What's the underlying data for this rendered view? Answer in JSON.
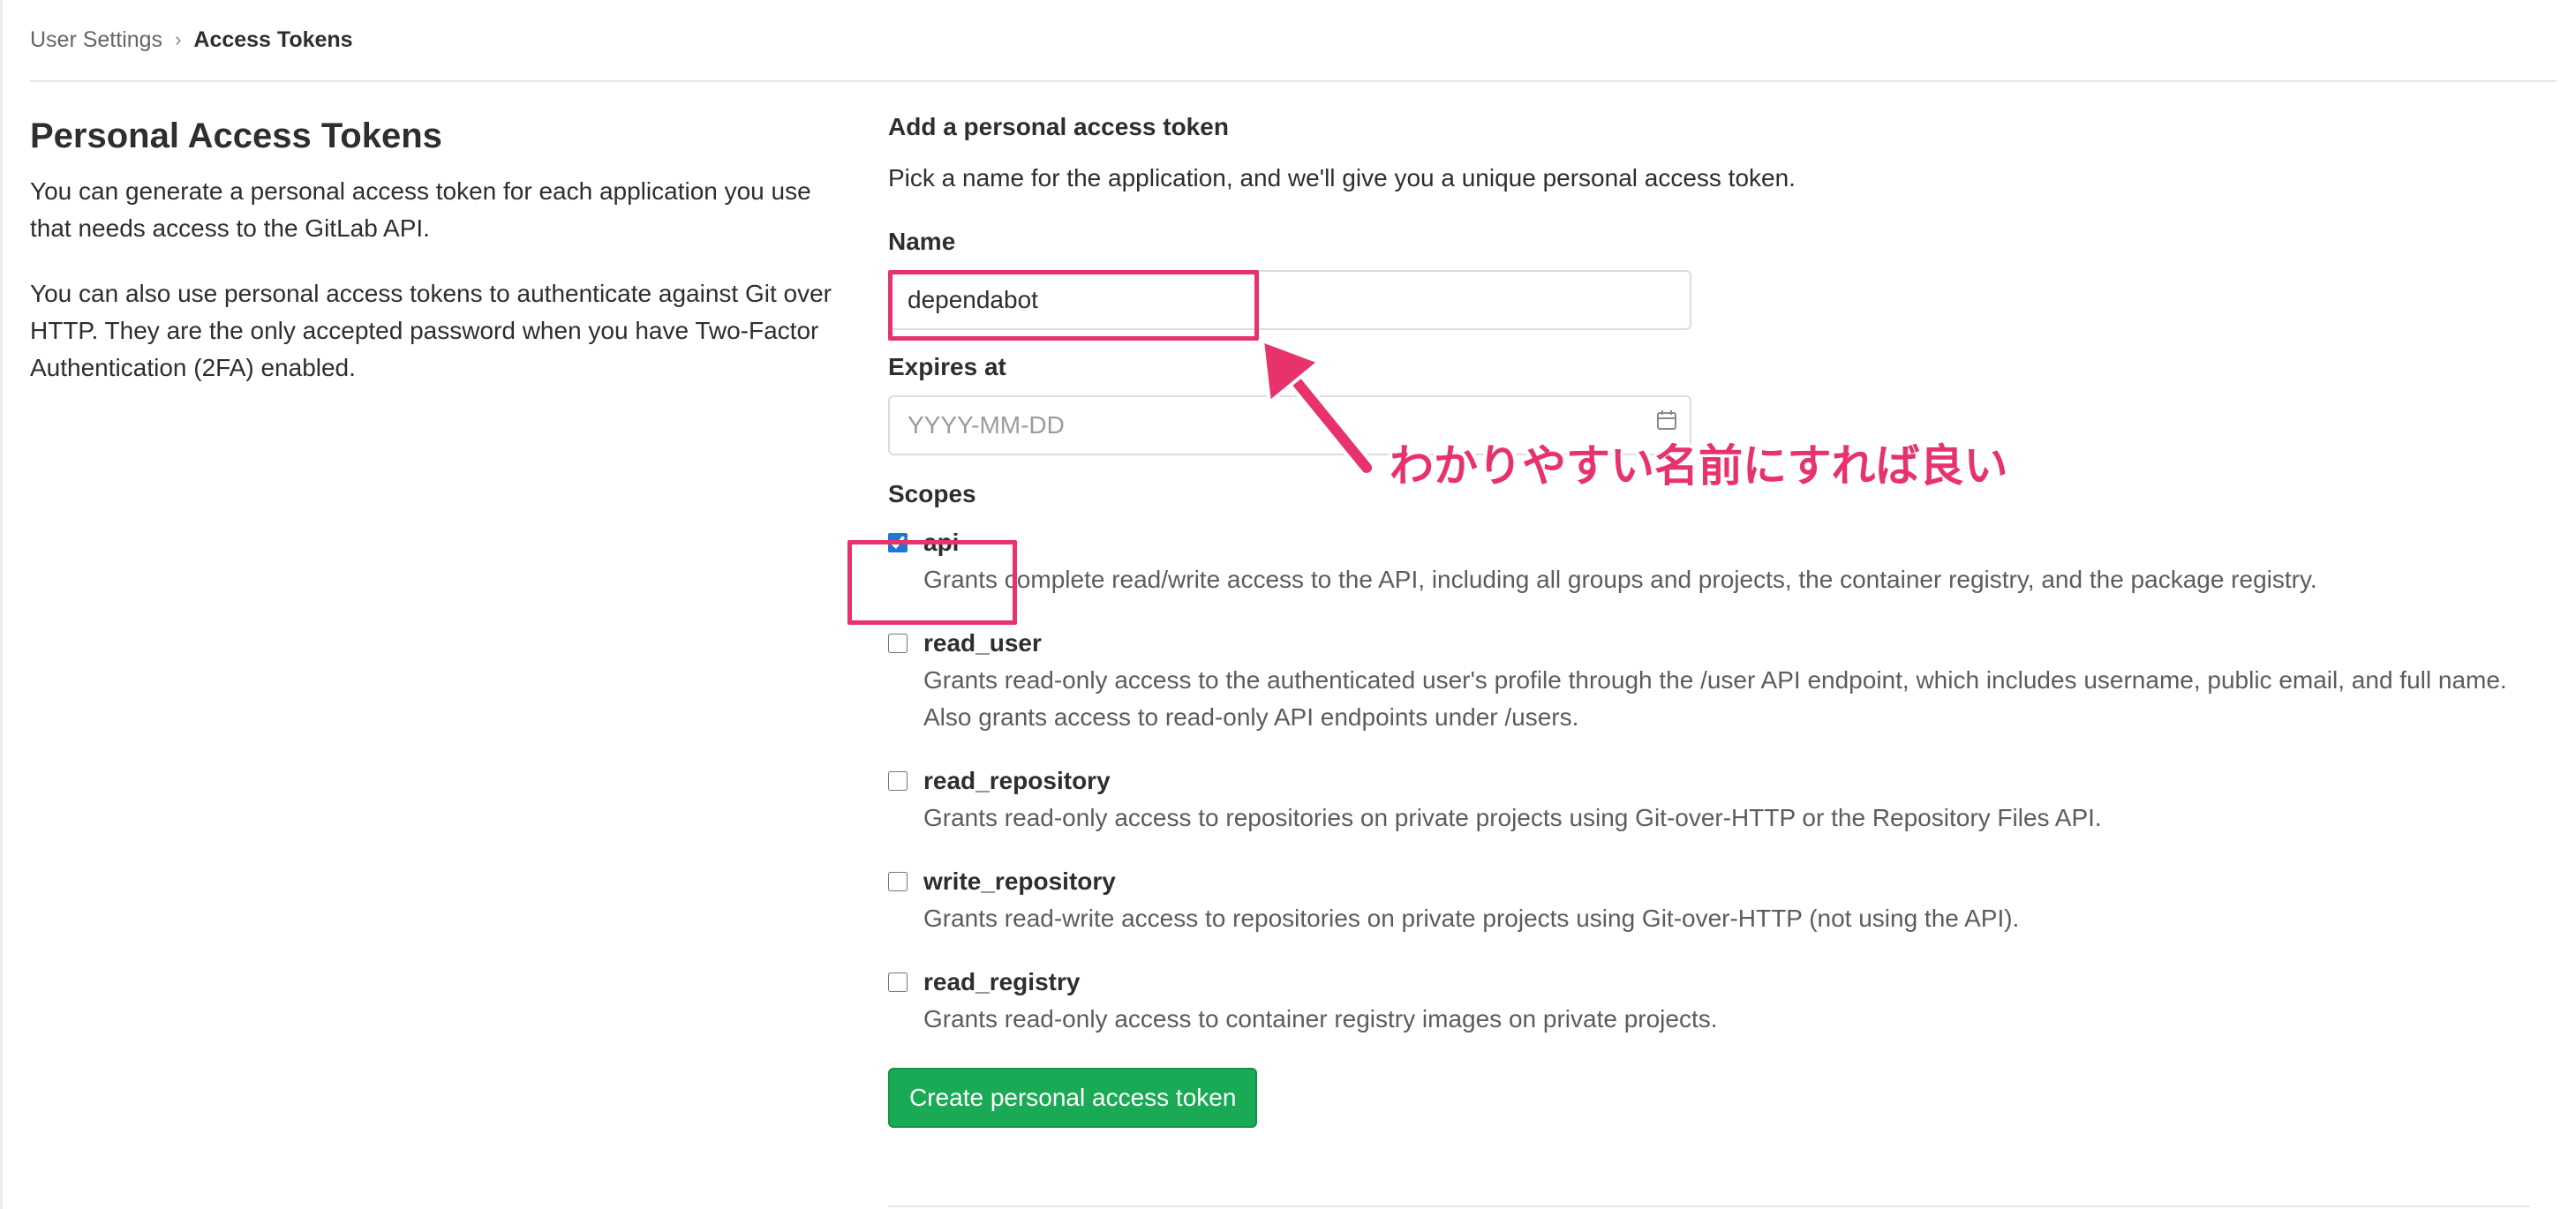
{
  "breadcrumb": {
    "parent": "User Settings",
    "separator": "›",
    "current": "Access Tokens"
  },
  "intro": {
    "title": "Personal Access Tokens",
    "paragraph1": "You can generate a personal access token for each application you use that needs access to the GitLab API.",
    "paragraph2": "You can also use personal access tokens to authenticate against Git over HTTP. They are the only accepted password when you have Two-Factor Authentication (2FA) enabled."
  },
  "form": {
    "heading": "Add a personal access token",
    "description": "Pick a name for the application, and we'll give you a unique personal access token.",
    "name_label": "Name",
    "name_value": "dependabot",
    "expires_label": "Expires at",
    "expires_placeholder": "YYYY-MM-DD",
    "scopes_label": "Scopes",
    "scopes": [
      {
        "name": "api",
        "checked": true,
        "description": "Grants complete read/write access to the API, including all groups and projects, the container registry, and the package registry."
      },
      {
        "name": "read_user",
        "checked": false,
        "description": "Grants read-only access to the authenticated user's profile through the /user API endpoint, which includes username, public email, and full name. Also grants access to read-only API endpoints under /users."
      },
      {
        "name": "read_repository",
        "checked": false,
        "description": "Grants read-only access to repositories on private projects using Git-over-HTTP or the Repository Files API."
      },
      {
        "name": "write_repository",
        "checked": false,
        "description": "Grants read-write access to repositories on private projects using Git-over-HTTP (not using the API)."
      },
      {
        "name": "read_registry",
        "checked": false,
        "description": "Grants read-only access to container registry images on private projects."
      }
    ],
    "submit_label": "Create personal access token"
  },
  "annotation": {
    "text": "わかりやすい名前にすれば良い",
    "color": "#e7326b"
  },
  "colors": {
    "primary_button": "#1aaa55",
    "checkbox_accent": "#1f78d1",
    "annotation": "#e7326b"
  },
  "icons": {
    "calendar": "calendar-icon",
    "breadcrumb_separator": "chevron-right-icon"
  }
}
